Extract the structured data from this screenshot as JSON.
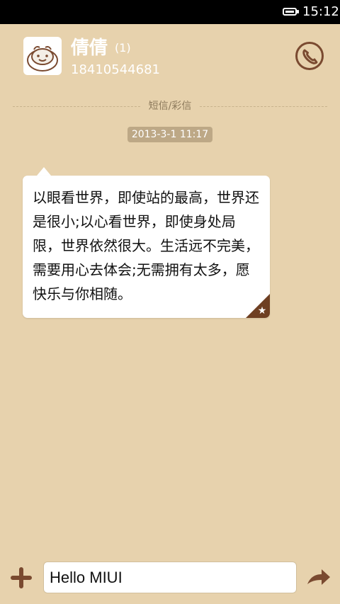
{
  "status_bar": {
    "time": "15:12",
    "battery_level": 1.0
  },
  "contact": {
    "name": "倩倩",
    "unread_count": "(1)",
    "phone": "18410544681",
    "avatar_icon": "cartoon-bear-icon",
    "call_icon": "phone-icon"
  },
  "thread": {
    "channel_label": "短信/彩信",
    "timestamp": "2013-3-1 11:17",
    "messages": [
      {
        "text": "以眼看世界，即使站的最高，世界还是很小;以心看世界，即使身处局限，世界依然很大。生活远不完美，需要用心去体会;无需拥有太多，愿快乐与你相随。",
        "favorite_icon": "star-icon"
      }
    ]
  },
  "composer": {
    "value": "Hello MIUI",
    "add_icon": "plus-icon",
    "send_icon": "send-arrow-icon"
  },
  "colors": {
    "background": "#e7d2ad",
    "accent_brown": "#7a4a30",
    "timestamp_pill": "#bda886"
  }
}
